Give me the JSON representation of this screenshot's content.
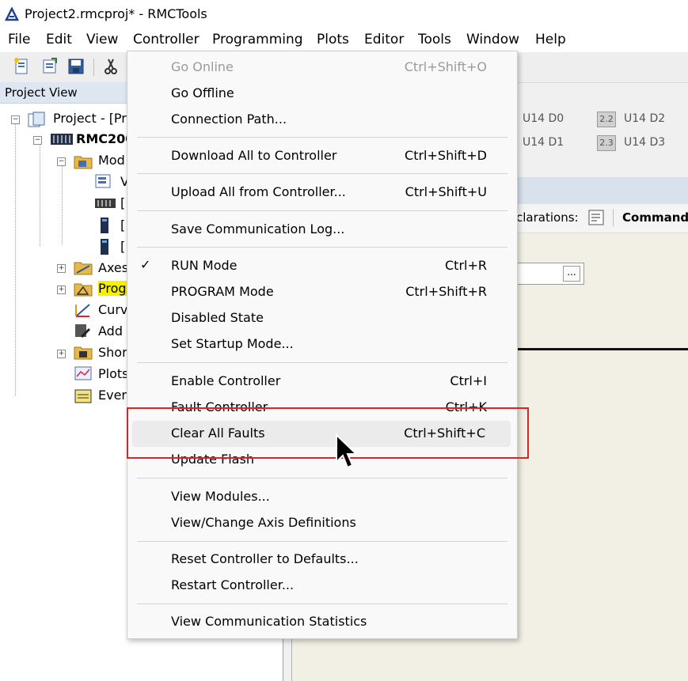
{
  "window": {
    "title": "Project2.rmcproj* - RMCTools",
    "accent": "#1f3f8f"
  },
  "menubar": {
    "items": [
      "File",
      "Edit",
      "View",
      "Controller",
      "Programming",
      "Plots",
      "Editor",
      "Tools",
      "Window",
      "Help"
    ]
  },
  "project_view": {
    "title": "Project View",
    "tree": [
      {
        "label": "Project - [Pr",
        "icon": "project-icon"
      },
      {
        "label": "RMC200",
        "icon": "controller-icon"
      },
      {
        "label": "Mod",
        "icon": "modules-folder-icon"
      },
      {
        "label": "V",
        "icon": "module-icon"
      },
      {
        "label": "[",
        "icon": "rack-icon"
      },
      {
        "label": "[",
        "icon": "module-card-icon"
      },
      {
        "label": "[",
        "icon": "module-card-icon"
      },
      {
        "label": "Axes",
        "icon": "axes-icon"
      },
      {
        "label": "Prog",
        "icon": "programs-icon"
      },
      {
        "label": "Curv",
        "icon": "curves-icon"
      },
      {
        "label": "Add",
        "icon": "add-icon"
      },
      {
        "label": "Shor",
        "icon": "shortcuts-icon"
      },
      {
        "label": "Plots",
        "icon": "plots-icon"
      },
      {
        "label": "Ever",
        "icon": "events-icon"
      }
    ]
  },
  "registers": [
    {
      "box": "",
      "label": "U14 D0"
    },
    {
      "box": "2.2",
      "label": "U14 D2"
    },
    {
      "box": "",
      "label": "U14 D1"
    },
    {
      "box": "2.3",
      "label": "U14 D3"
    }
  ],
  "right_toolbar": {
    "declarations_label": "clarations:",
    "command_label": "Command:"
  },
  "editor": {
    "dots": "..."
  },
  "controller_menu": {
    "groups": [
      [
        {
          "label": "Go Online",
          "shortcut": "Ctrl+Shift+O",
          "disabled": true
        },
        {
          "label": "Go Offline",
          "shortcut": ""
        },
        {
          "label": "Connection Path...",
          "shortcut": ""
        }
      ],
      [
        {
          "label": "Download All to Controller",
          "shortcut": "Ctrl+Shift+D"
        }
      ],
      [
        {
          "label": "Upload All from Controller...",
          "shortcut": "Ctrl+Shift+U"
        }
      ],
      [
        {
          "label": "Save Communication Log...",
          "shortcut": ""
        }
      ],
      [
        {
          "label": "RUN Mode",
          "shortcut": "Ctrl+R",
          "checked": true
        },
        {
          "label": "PROGRAM Mode",
          "shortcut": "Ctrl+Shift+R"
        },
        {
          "label": "Disabled State",
          "shortcut": ""
        },
        {
          "label": "Set Startup Mode...",
          "shortcut": ""
        }
      ],
      [
        {
          "label": "Enable Controller",
          "shortcut": "Ctrl+I"
        },
        {
          "label": "Fault Controller",
          "shortcut": "Ctrl+K"
        },
        {
          "label": "Clear All Faults",
          "shortcut": "Ctrl+Shift+C",
          "hover": true
        },
        {
          "label": "Update Flash",
          "shortcut": ""
        }
      ],
      [
        {
          "label": "View Modules...",
          "shortcut": ""
        },
        {
          "label": "View/Change Axis Definitions",
          "shortcut": ""
        }
      ],
      [
        {
          "label": "Reset Controller to Defaults...",
          "shortcut": ""
        },
        {
          "label": "Restart Controller...",
          "shortcut": ""
        }
      ],
      [
        {
          "label": "View Communication Statistics",
          "shortcut": ""
        }
      ]
    ],
    "checkmark": "✓"
  },
  "annotation": {
    "color": "#d9252a"
  }
}
